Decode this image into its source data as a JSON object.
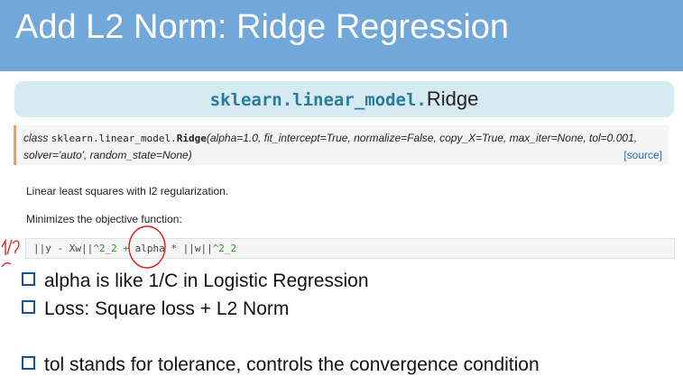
{
  "slide": {
    "title": "Add L2 Norm: Ridge Regression"
  },
  "doc": {
    "module": "sklearn.linear_model.",
    "class_name": "Ridge",
    "signature": {
      "class_kw": "class ",
      "module": "sklearn.linear_model.",
      "name": "Ridge",
      "params_line1": "(alpha=1.0, fit_intercept=True, normalize=False, copy_X=True, max_iter=None, tol=0.001,",
      "params_line2": "solver='auto', random_state=None)",
      "source_link": "[source]"
    },
    "description": "Linear least squares with l2 regularization.",
    "objective_label": "Minimizes the objective function:",
    "formula": {
      "part1": "||y - Xw||",
      "part2": "^2_2 + ",
      "part3": "alpha * ||w||",
      "part4": "^2_2"
    }
  },
  "annotation": {
    "handwritten_mark": "1/?"
  },
  "bullets": [
    "alpha is like 1/C in Logistic Regression",
    "Loss: Square loss + L2 Norm",
    "tol stands for tolerance, controls the convergence condition"
  ],
  "colors": {
    "title_bar": "#72a7d9",
    "doc_header_bg": "#d6eaf2",
    "annotation_red": "#d42020",
    "bullet_box": "#1a4f9a"
  }
}
